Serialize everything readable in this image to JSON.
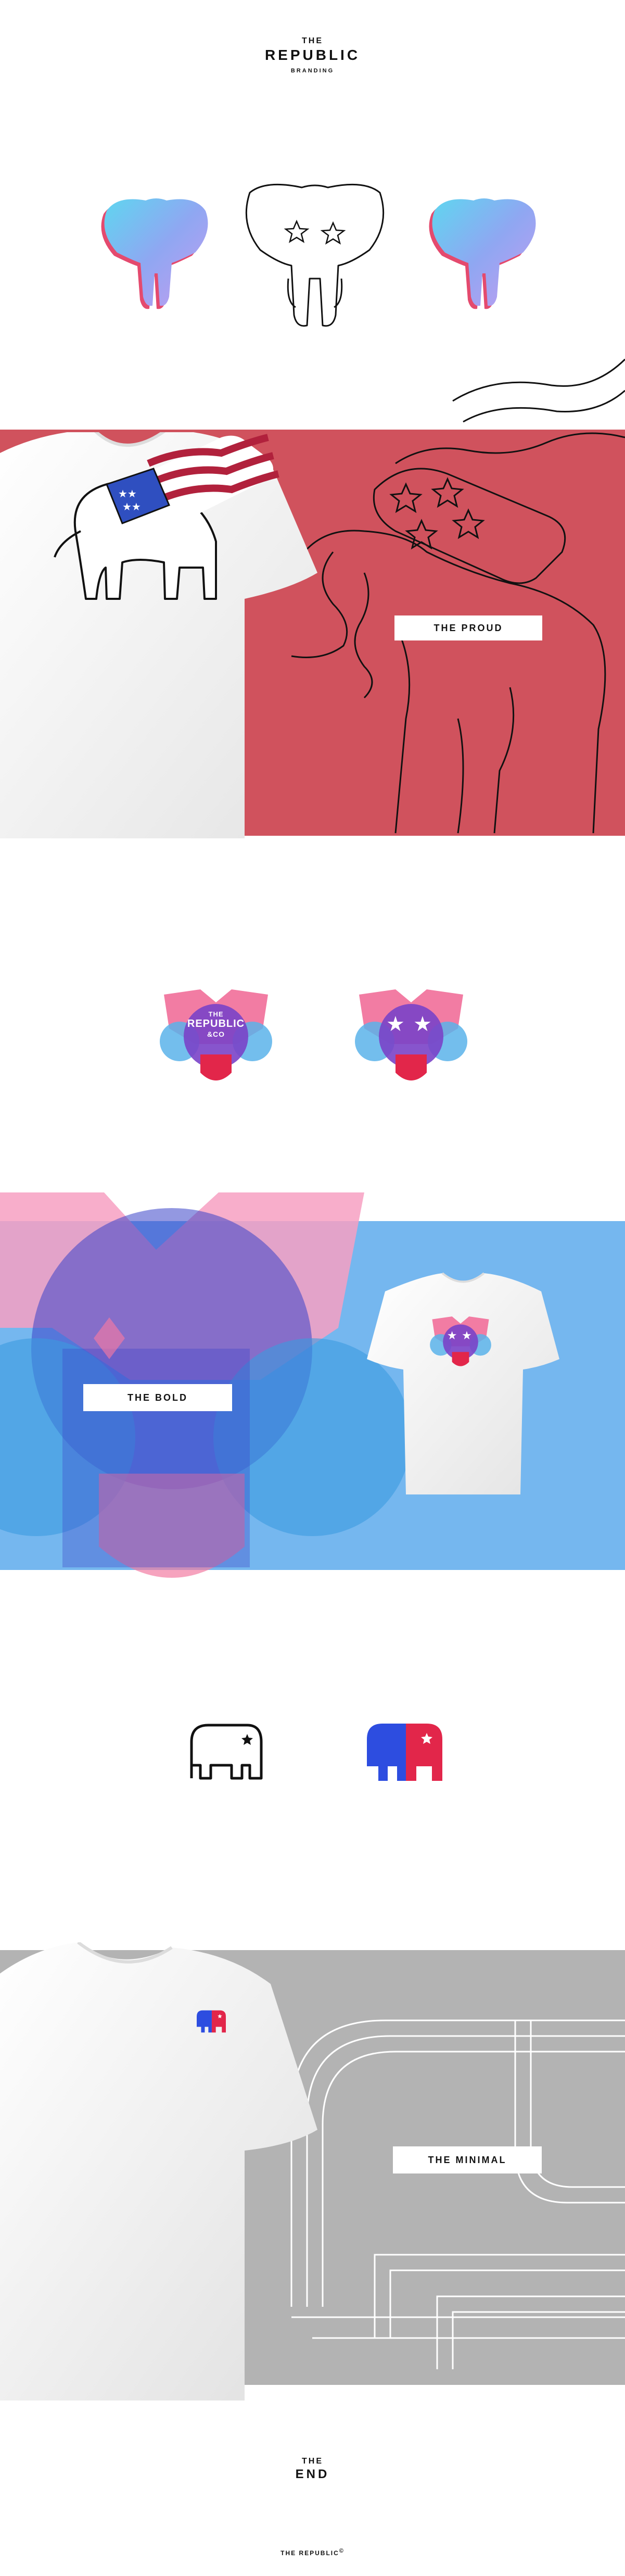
{
  "header": {
    "line1": "THE",
    "line2": "REPUBLIC",
    "line3": "BRANDING"
  },
  "sections": {
    "proud_label": "THE PROUD",
    "bold_label": "THE BOLD",
    "minimal_label": "THE MINIMAL"
  },
  "badge_logo": {
    "line1": "THE",
    "line2": "REPUBLIC",
    "line3": "&CO"
  },
  "footer": {
    "line1": "THE",
    "line2": "END",
    "signature": "THE REPUBLIC",
    "signature_mark": "©"
  },
  "colors": {
    "proud_red": "#d0525d",
    "bold_blue": "#75b7ef",
    "minimal_gray": "#b3b3b3",
    "logo_blue": "#2d4de0",
    "logo_red": "#e2264a",
    "pink": "#f27ca3",
    "purple": "#7a42c8"
  },
  "icons": [
    "elephant-head-gradient-icon",
    "elephant-head-outline-icon",
    "elephant-flag-icon",
    "elephant-badge-icon",
    "elephant-minimal-outline-icon",
    "elephant-minimal-color-icon"
  ]
}
